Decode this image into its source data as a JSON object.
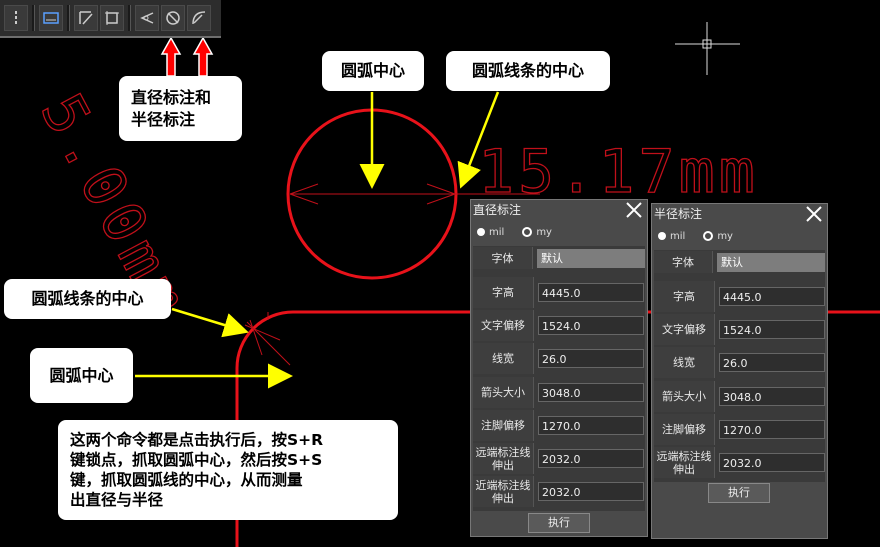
{
  "toolbar": {
    "buttons": [
      {
        "icon": "vertical-line-icon"
      },
      {
        "icon": "dimension-icon"
      },
      {
        "icon": "align-icon"
      },
      {
        "icon": "frame-icon"
      },
      {
        "icon": "angle-icon"
      },
      {
        "icon": "diameter-icon"
      },
      {
        "icon": "radius-icon"
      }
    ]
  },
  "canvas": {
    "dim_text_large": "15.17mm",
    "dim_text_diag": "5.00mm"
  },
  "callouts": {
    "dim_radius_line1": "直径标注和",
    "dim_radius_line2": "半径标注",
    "arc_center_top": "圆弧中心",
    "arc_line_center_top": "圆弧线条的中心",
    "arc_line_center_left": "圆弧线条的中心",
    "arc_center_left": "圆弧中心",
    "instruction_line1": "这两个命令都是点击执行后，按S+R",
    "instruction_line2": "键锁点，抓取圆弧中心，然后按S+S",
    "instruction_line3": "键，抓取圆弧线的中心，从而测量",
    "instruction_line4": "出直径与半径"
  },
  "diameter_dialog": {
    "title": "直径标注",
    "unit_mil": "mil",
    "unit_my": "my",
    "font_label": "字体",
    "font_value": "默认",
    "fields": [
      {
        "label": "字高",
        "value": "4445.0"
      },
      {
        "label": "文字偏移",
        "value": "1524.0"
      },
      {
        "label": "线宽",
        "value": "26.0"
      },
      {
        "label": "箭头大小",
        "value": "3048.0"
      },
      {
        "label": "注脚偏移",
        "value": "1270.0"
      },
      {
        "label_l1": "远端标注线",
        "label_l2": "伸出",
        "value": "2032.0"
      },
      {
        "label_l1": "近端标注线",
        "label_l2": "伸出",
        "value": "2032.0"
      }
    ],
    "exec_label": "执行"
  },
  "radius_dialog": {
    "title": "半径标注",
    "unit_mil": "mil",
    "unit_my": "my",
    "font_label": "字体",
    "font_value": "默认",
    "fields": [
      {
        "label": "字高",
        "value": "4445.0"
      },
      {
        "label": "文字偏移",
        "value": "1524.0"
      },
      {
        "label": "线宽",
        "value": "26.0"
      },
      {
        "label": "箭头大小",
        "value": "3048.0"
      },
      {
        "label": "注脚偏移",
        "value": "1270.0"
      },
      {
        "label_l1": "远端标注线",
        "label_l2": "伸出",
        "value": "2032.0"
      }
    ],
    "exec_label": "执行"
  },
  "colors": {
    "background": "#000000",
    "trace": "#e8121a",
    "annotation_arrow": "#ffff00",
    "red_arrow": "#ff0000"
  }
}
